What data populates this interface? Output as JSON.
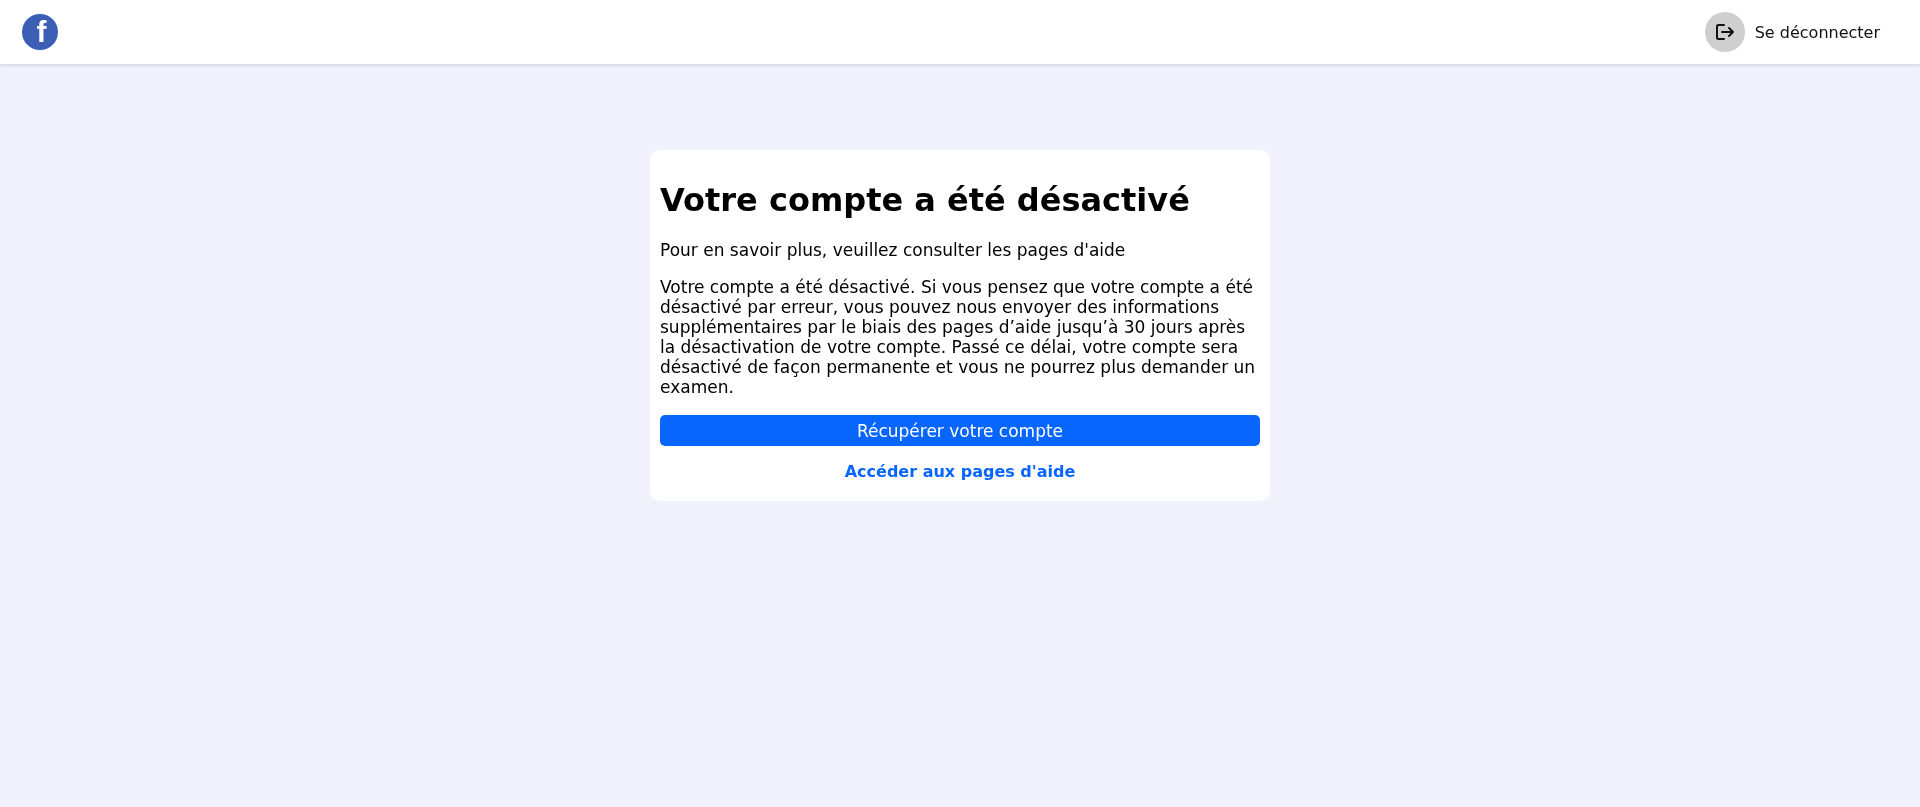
{
  "header": {
    "logo": "f",
    "logout": {
      "label": "Se déconnecter"
    }
  },
  "card": {
    "title": "Votre compte a été désactivé",
    "subtitle": "Pour en savoir plus, veuillez consulter les pages d'aide",
    "body": "Votre compte a été désactivé. Si vous pensez que votre compte a été désactivé par erreur, vous pouvez nous envoyer des informations supplémentaires par le biais des pages d’aide jusqu’à 30 jours après la désactivation de votre compte. Passé ce délai, votre compte sera désactivé de façon permanente et vous ne pourrez plus demander un examen.",
    "primary_button": "Récupérer votre compte",
    "help_link": "Accéder aux pages d'aide"
  }
}
